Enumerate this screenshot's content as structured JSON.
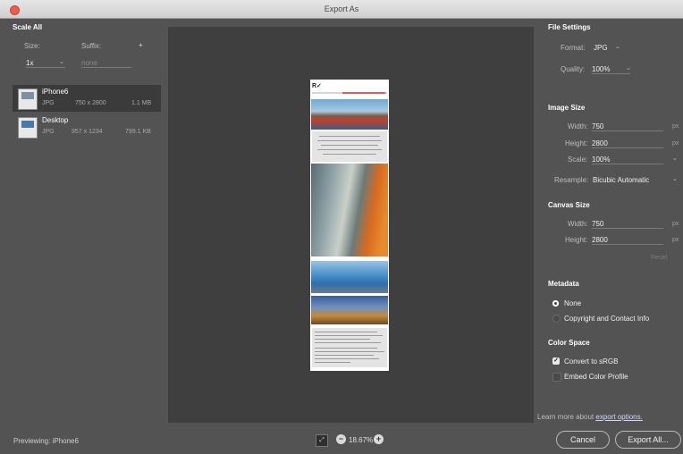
{
  "window": {
    "title": "Export As"
  },
  "left_panel": {
    "heading": "Scale All",
    "size_label": "Size:",
    "suffix_label": "Suffix:",
    "add_symbol": "+",
    "size_value": "1x",
    "suffix_placeholder": "none",
    "assets": [
      {
        "name": "iPhone6",
        "format": "JPG",
        "dimensions": "750 x 2800",
        "size": "1.1 MB",
        "selected": true
      },
      {
        "name": "Desktop",
        "format": "JPG",
        "dimensions": "957 x 1234",
        "size": "799.1 KB",
        "selected": false
      }
    ]
  },
  "file_settings": {
    "heading": "File Settings",
    "format_label": "Format:",
    "format_value": "JPG",
    "quality_label": "Quality:",
    "quality_value": "100%"
  },
  "image_size": {
    "heading": "Image Size",
    "width_label": "Width:",
    "width_value": "750",
    "height_label": "Height:",
    "height_value": "2800",
    "scale_label": "Scale:",
    "scale_value": "100%",
    "resample_label": "Resample:",
    "resample_value": "Bicubic Automatic",
    "unit": "px"
  },
  "canvas_size": {
    "heading": "Canvas Size",
    "width_label": "Width:",
    "width_value": "750",
    "height_label": "Height:",
    "height_value": "2800",
    "unit": "px",
    "reset_label": "Reset"
  },
  "metadata": {
    "heading": "Metadata",
    "option_none": "None",
    "option_copyright": "Copyright and Contact Info"
  },
  "color_space": {
    "heading": "Color Space",
    "convert_label": "Convert to sRGB",
    "embed_label": "Embed Color Profile"
  },
  "learn_more": {
    "prefix": "Learn more about ",
    "link": "export options."
  },
  "status": {
    "previewing": "Previewing: iPhone6",
    "zoom": "18.67%"
  },
  "buttons": {
    "cancel": "Cancel",
    "export_all": "Export All..."
  },
  "preview_doc": {
    "logo": "R✓"
  }
}
